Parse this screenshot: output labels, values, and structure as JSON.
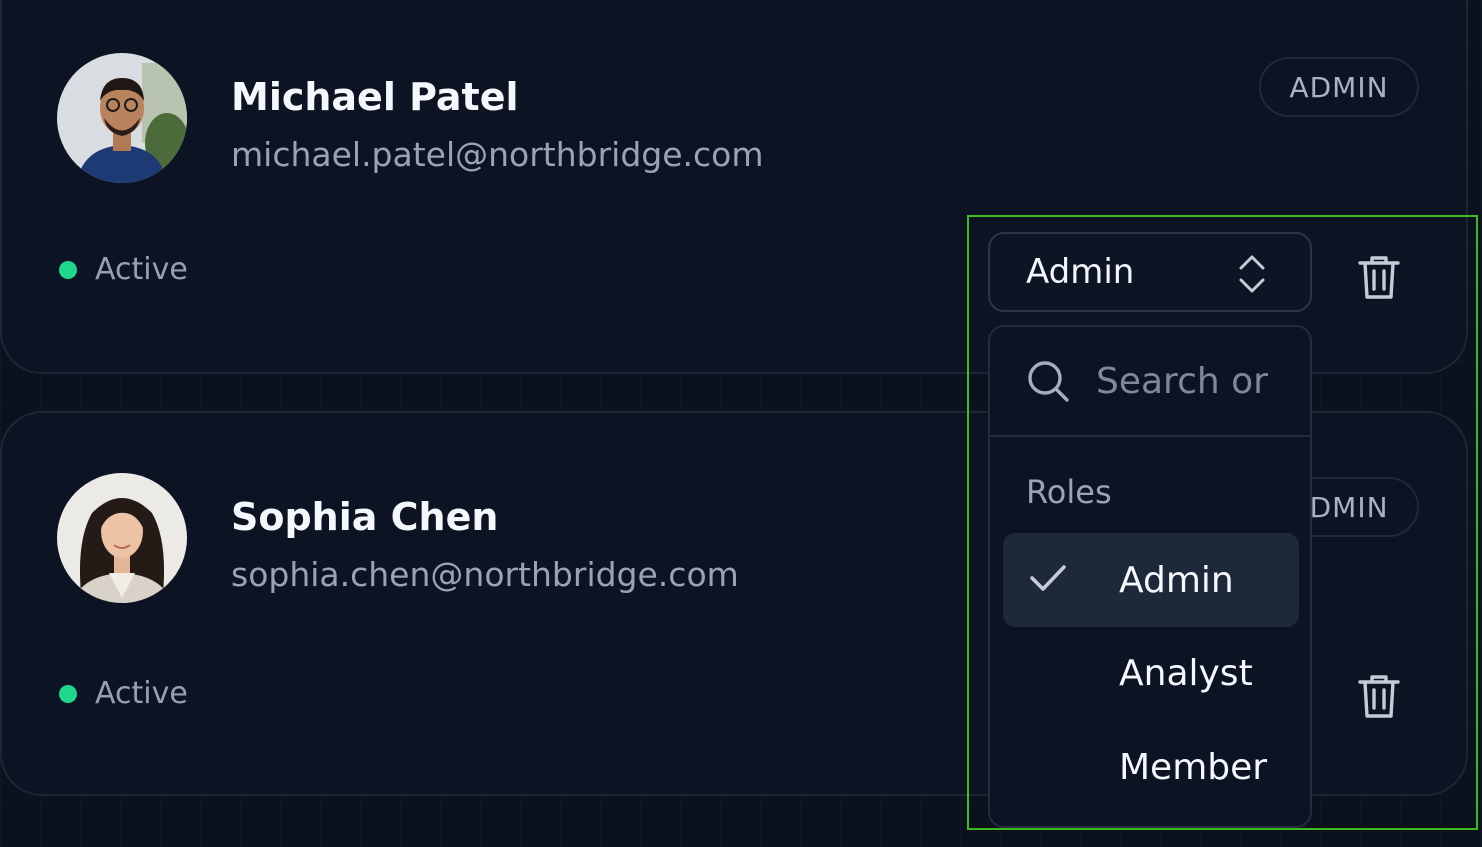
{
  "users": [
    {
      "name": "Michael Patel",
      "email": "michael.patel@northbridge.com",
      "role_badge": "ADMIN",
      "status": "Active",
      "role_select": "Admin"
    },
    {
      "name": "Sophia Chen",
      "email": "sophia.chen@northbridge.com",
      "role_badge": "ADMIN",
      "status": "Active"
    }
  ],
  "role_menu": {
    "search_placeholder": "Search or",
    "group_label": "Roles",
    "options": [
      {
        "label": "Admin",
        "selected": true
      },
      {
        "label": "Analyst",
        "selected": false
      },
      {
        "label": "Member",
        "selected": false
      }
    ]
  },
  "colors": {
    "background": "#0b111d",
    "card": "#0c1322",
    "status_active": "#1fd68c",
    "focus_ring": "#3cba1f",
    "selected_option": "#1d283a"
  },
  "icons": [
    "avatar-photo",
    "chevron-updown-icon",
    "trash-icon",
    "search-icon",
    "check-icon"
  ]
}
